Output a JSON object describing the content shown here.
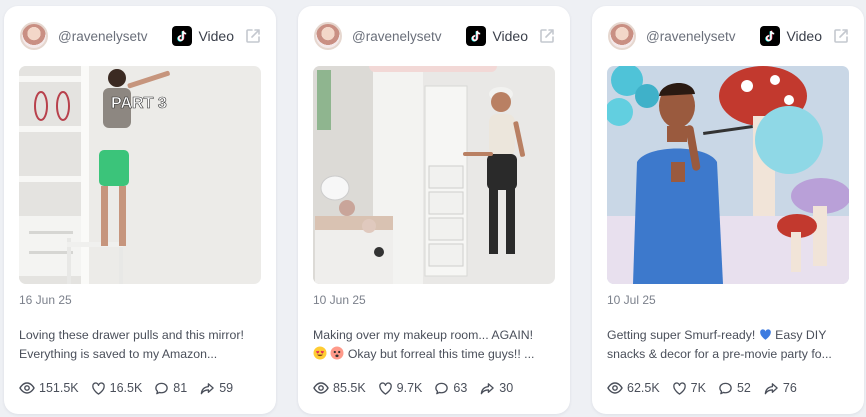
{
  "cards": [
    {
      "handle": "@ravenelysetv",
      "type_label": "Video",
      "overlay_text": "PART 3",
      "date": "16 Jun 25",
      "caption_line1": "Loving these drawer pulls and this mirror!",
      "caption_line2": "Everything is saved to my Amazon...",
      "views": "151.5K",
      "likes": "16.5K",
      "comments": "81",
      "shares": "59"
    },
    {
      "handle": "@ravenelysetv",
      "type_label": "Video",
      "date": "10 Jun 25",
      "caption_line1": "Making over my makeup room... AGAIN!",
      "caption_line2": "Okay but forreal this time guys!! ...",
      "views": "85.5K",
      "likes": "9.7K",
      "comments": "63",
      "shares": "30"
    },
    {
      "handle": "@ravenelysetv",
      "type_label": "Video",
      "date": "10 Jul 25",
      "caption_line1": "Getting super Smurf-ready!",
      "caption_line1b": "Easy DIY",
      "caption_line2": "snacks & decor for a pre-movie party fo...",
      "views": "62.5K",
      "likes": "7K",
      "comments": "52",
      "shares": "76"
    }
  ],
  "icons": {
    "platform": "tiktok-icon",
    "external": "external-link-icon",
    "views": "eye-icon",
    "likes": "heart-icon",
    "comments": "comment-icon",
    "shares": "share-icon"
  },
  "colors": {
    "page_bg": "#eef0f4",
    "card_bg": "#ffffff",
    "text": "#3a3f4a",
    "muted": "#7b808b",
    "heart_emoji": "#3d7be0"
  }
}
